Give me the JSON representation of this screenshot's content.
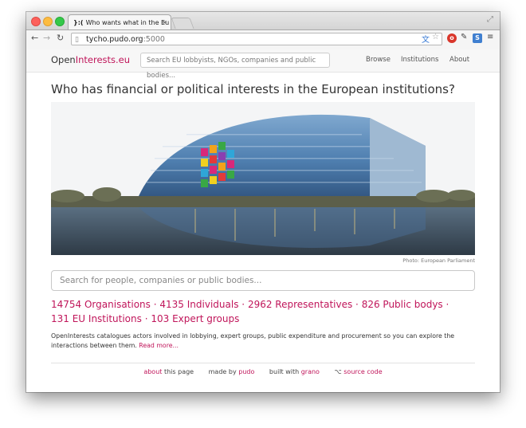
{
  "browser": {
    "tab_title": "Who wants what in the Eu",
    "url_host": "tycho.pudo.org",
    "url_port": ":5000"
  },
  "site": {
    "brand_prefix": "Open",
    "brand_accent": "Interests.eu",
    "search_placeholder": "Search EU lobbyists, NGOs, companies and public bodies...",
    "nav": [
      "Browse",
      "Institutions",
      "About"
    ]
  },
  "main": {
    "headline": "Who has financial or political interests in the European institutions?",
    "photo_credit": "Photo: European Parliament",
    "search_placeholder": "Search for people, companies or public bodies...",
    "stats": [
      "14754 Organisations",
      "4135 Individuals",
      "2962 Representatives",
      "826 Public bodys",
      "131 EU Institutions",
      "103 Expert groups"
    ],
    "about_text": "OpenInterests catalogues actors involved in lobbying, expert groups, public expenditure and procurement so you can explore the interactions between them.",
    "read_more": "Read more..."
  },
  "footer": {
    "about_link": "about",
    "about_rest": "this page",
    "made_by": "made by",
    "made_by_link": "pudo",
    "built_with": "built with",
    "built_with_link": "grano",
    "source_link": "source code"
  },
  "colors": {
    "accent": "#c0155a"
  }
}
